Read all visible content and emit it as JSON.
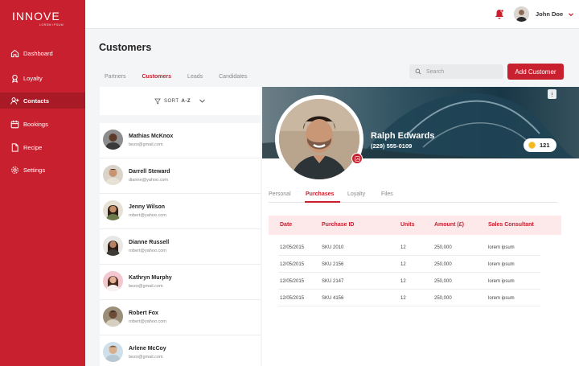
{
  "brand": {
    "name": "INNOVE",
    "tagline": "LOREM IPSUM"
  },
  "sidebar": {
    "items": [
      {
        "label": "Dashboard",
        "icon": "home-icon",
        "active": false
      },
      {
        "label": "Loyalty",
        "icon": "award-icon",
        "active": false
      },
      {
        "label": "Contacts",
        "icon": "user-plus-icon",
        "active": true
      },
      {
        "label": "Bookings",
        "icon": "calendar-icon",
        "active": false
      },
      {
        "label": "Recipe",
        "icon": "document-icon",
        "active": false
      },
      {
        "label": "Settings",
        "icon": "gear-icon",
        "active": false
      }
    ]
  },
  "topbar": {
    "user_name": "John Doe"
  },
  "page": {
    "title": "Customers"
  },
  "tabs": [
    "Partners",
    "Customers",
    "Leads",
    "Candidates"
  ],
  "search": {
    "placeholder": "Search"
  },
  "add_button": "Add Customer",
  "sort": {
    "label": "SORT",
    "value": "A-Z"
  },
  "customers": [
    {
      "name": "Mathias  McKnox",
      "email": "bezo@gmail.com"
    },
    {
      "name": "Darrell Steward",
      "email": "dianne@yahoo.com"
    },
    {
      "name": "Jenny Wilson",
      "email": "robert@yahoo.com"
    },
    {
      "name": "Dianne Russell",
      "email": "robert@yahoo.com"
    },
    {
      "name": "Kathryn Murphy",
      "email": "bezo@gmail.com"
    },
    {
      "name": "Robert Fox",
      "email": "robert@yahoo.com"
    },
    {
      "name": "Arlene McCoy",
      "email": "bezo@gmail.com"
    }
  ],
  "profile": {
    "name": "Ralph Edwards",
    "phone": "(229) 555-0109",
    "points": "121"
  },
  "detail_tabs": [
    "Personal",
    "Purchases",
    "Loyalty",
    "Files"
  ],
  "purchases": {
    "headers": [
      "Date",
      "Purchase ID",
      "Units",
      "Amount (£)",
      "Sales Consultant"
    ],
    "rows": [
      [
        "12/05/2015",
        "SKU 2010",
        "12",
        "250,000",
        "lorem ipsum"
      ],
      [
        "12/05/2015",
        "SKU 2156",
        "12",
        "250,000",
        "lorem ipsum"
      ],
      [
        "12/05/2015",
        "SKU 2147",
        "12",
        "250,000",
        "lorem ipsum"
      ],
      [
        "12/05/2015",
        "SKU 4156",
        "12",
        "250,000",
        "lorem ipsum"
      ]
    ]
  },
  "colors": {
    "brand": "#c8202f",
    "brand_dark": "#a81a26",
    "table_header_bg": "#fde9e9"
  }
}
